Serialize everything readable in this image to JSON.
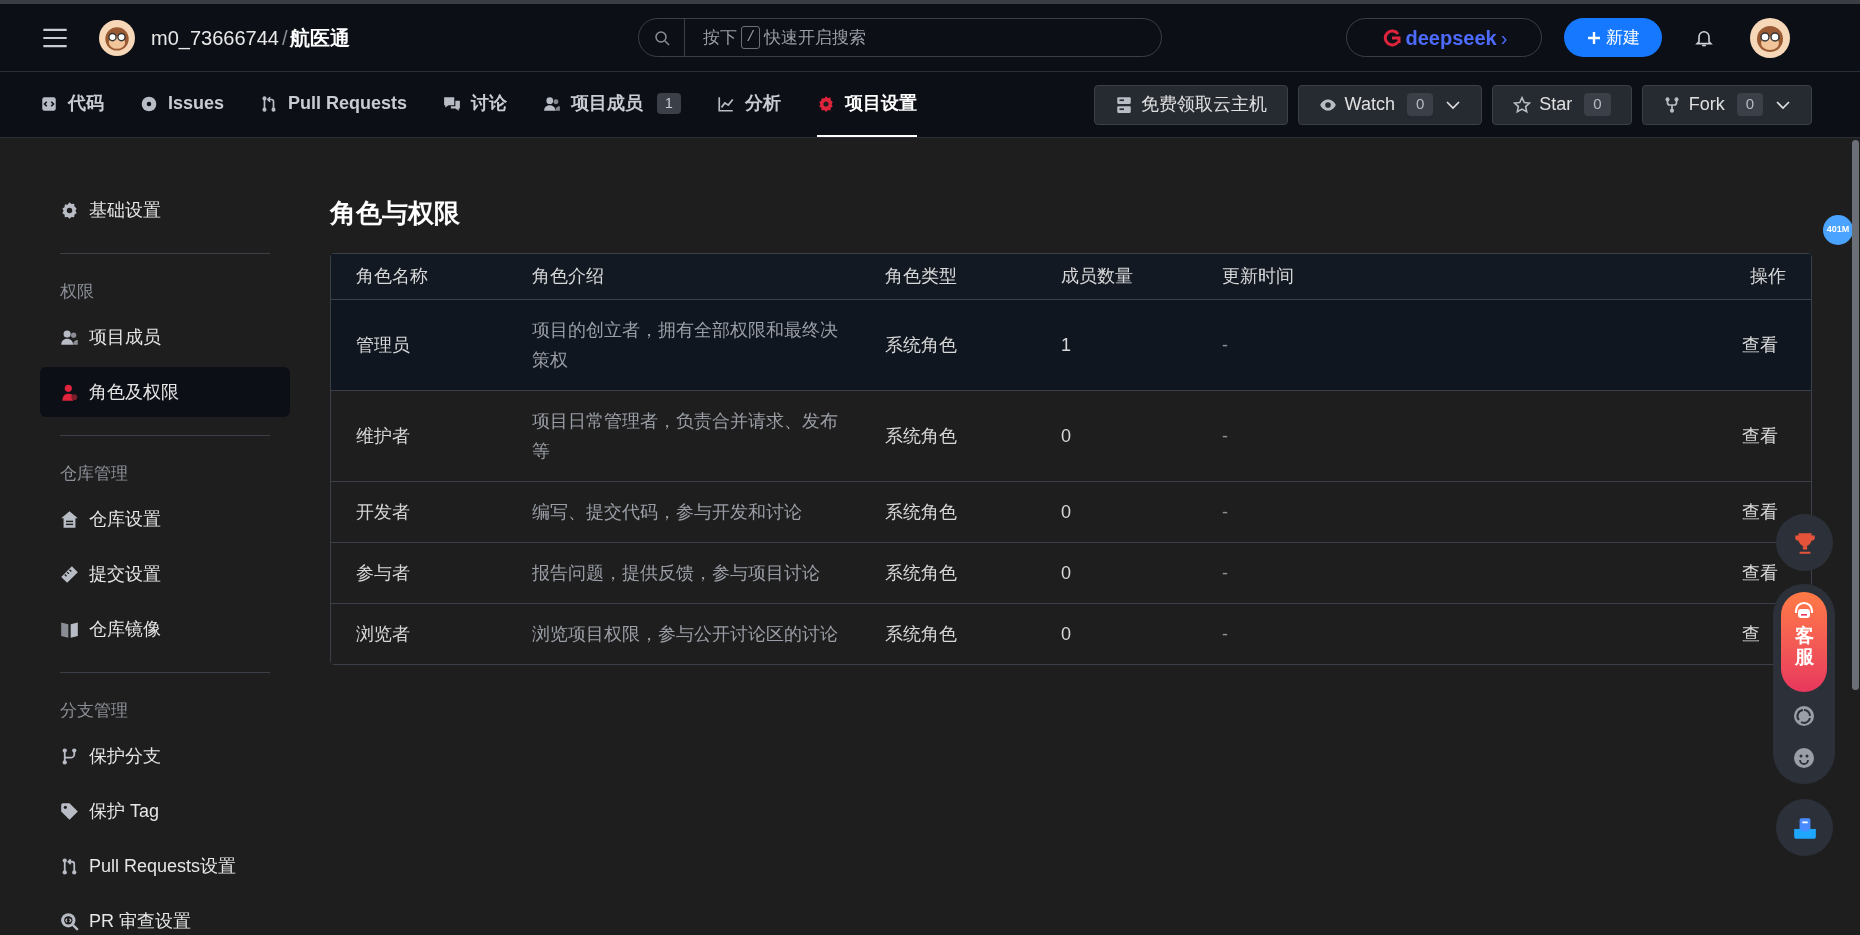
{
  "header": {
    "owner": "m0_73666744",
    "separator": "/",
    "repo": "航医通",
    "search": {
      "placeholder_before": "按下",
      "key": "/",
      "placeholder_after": "快速开启搜索"
    },
    "ai_button": "deepseek",
    "ai_arrow": "›",
    "new_button": "新建"
  },
  "tabs": [
    {
      "label": "代码",
      "selected": false
    },
    {
      "label": "Issues",
      "selected": false
    },
    {
      "label": "Pull Requests",
      "selected": false
    },
    {
      "label": "讨论",
      "selected": false
    },
    {
      "label": "项目成员",
      "count": "1",
      "selected": false
    },
    {
      "label": "分析",
      "selected": false
    },
    {
      "label": "项目设置",
      "selected": true
    }
  ],
  "repo_actions": [
    {
      "label": "免费领取云主机"
    },
    {
      "label": "Watch",
      "count": "0",
      "dropdown": true
    },
    {
      "label": "Star",
      "count": "0",
      "dropdown": false
    },
    {
      "label": "Fork",
      "count": "0",
      "dropdown": true
    }
  ],
  "sidebar": {
    "groups": [
      {
        "items": [
          {
            "label": "基础设置",
            "selected": false
          }
        ]
      },
      {
        "title": "权限",
        "items": [
          {
            "label": "项目成员",
            "selected": false
          },
          {
            "label": "角色及权限",
            "selected": true
          }
        ]
      },
      {
        "title": "仓库管理",
        "items": [
          {
            "label": "仓库设置",
            "selected": false
          },
          {
            "label": "提交设置",
            "selected": false
          },
          {
            "label": "仓库镜像",
            "selected": false
          }
        ]
      },
      {
        "title": "分支管理",
        "items": [
          {
            "label": "保护分支",
            "selected": false
          },
          {
            "label": "保护 Tag",
            "selected": false
          },
          {
            "label": "Pull Requests设置",
            "selected": false
          },
          {
            "label": "PR 审查设置",
            "selected": false
          }
        ]
      }
    ]
  },
  "page_title": "角色与权限",
  "table": {
    "columns": [
      "角色名称",
      "角色介绍",
      "角色类型",
      "成员数量",
      "更新时间",
      "操作"
    ],
    "rows": [
      {
        "name": "管理员",
        "description": "项目的创立者，拥有全部权限和最终决策权",
        "type": "系统角色",
        "members": "1",
        "updated": "-",
        "action": "查看",
        "selected": true
      },
      {
        "name": "维护者",
        "description": "项目日常管理者，负责合并请求、发布等",
        "type": "系统角色",
        "members": "0",
        "updated": "-",
        "action": "查看",
        "selected": false
      },
      {
        "name": "开发者",
        "description": "编写、提交代码，参与开发和讨论",
        "type": "系统角色",
        "members": "0",
        "updated": "-",
        "action": "查看",
        "selected": false
      },
      {
        "name": "参与者",
        "description": "报告问题，提供反馈，参与项目讨论",
        "type": "系统角色",
        "members": "0",
        "updated": "-",
        "action": "查看",
        "selected": false
      },
      {
        "name": "浏览者",
        "description": "浏览项目权限，参与公开讨论区的讨论",
        "type": "系统角色",
        "members": "0",
        "updated": "-",
        "action": "查",
        "selected": false
      }
    ]
  },
  "memory_badge": "401M",
  "float_tools": {
    "service_label": "客服"
  }
}
